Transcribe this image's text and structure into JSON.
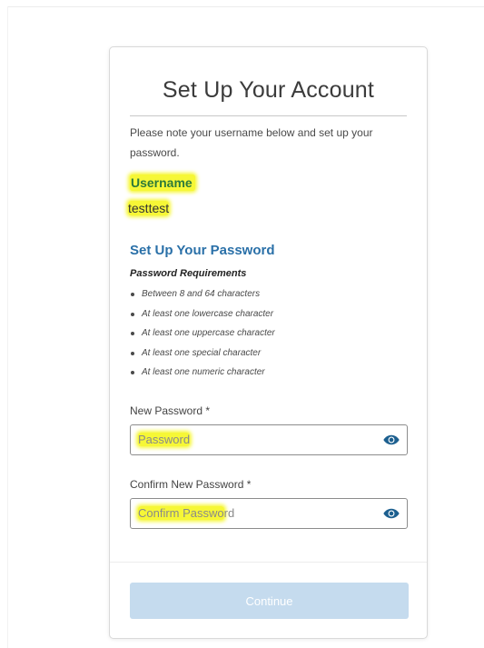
{
  "card": {
    "title": "Set Up Your Account",
    "intro": "Please note your username below and set up your password."
  },
  "account": {
    "username_label": "Username",
    "username_value": "testtest"
  },
  "password_section": {
    "title": "Set Up Your Password",
    "requirements_title": "Password Requirements",
    "requirements": [
      "Between 8 and 64 characters",
      "At least one lowercase character",
      "At least one uppercase character",
      "At least one special character",
      "At least one numeric character"
    ]
  },
  "fields": {
    "new_password": {
      "label": "New Password *",
      "placeholder_highlighted": "Password",
      "placeholder_rest": "",
      "value": ""
    },
    "confirm_password": {
      "label": "Confirm New Password *",
      "placeholder_highlighted": "Confirm Passwo",
      "placeholder_rest": "rd",
      "value": ""
    }
  },
  "footer": {
    "continue_label": "Continue"
  },
  "icons": {
    "reveal_password": "eye-icon"
  },
  "colors": {
    "section_title": "#2a70a8",
    "username_label": "#2d7a3a",
    "highlight": "#f6f736",
    "continue_button_disabled": "#c5dbee",
    "eye_icon": "#1c5f8f"
  }
}
